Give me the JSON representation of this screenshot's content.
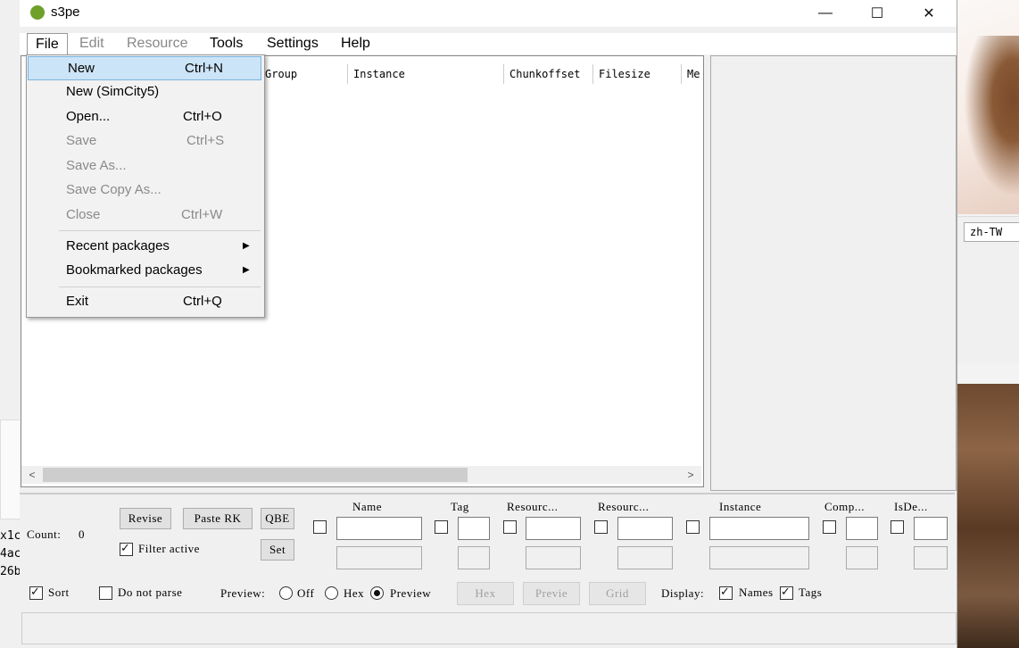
{
  "window": {
    "title": "s3pe",
    "minimize_glyph": "—",
    "maximize_glyph": "☐",
    "close_glyph": "✕"
  },
  "menubar": {
    "file": "File",
    "edit": "Edit",
    "resource": "Resource",
    "tools": "Tools",
    "settings": "Settings",
    "help": "Help"
  },
  "file_menu": {
    "new": {
      "label": "New",
      "shortcut": "Ctrl+N"
    },
    "new_simcity": {
      "label": "New (SimCity5)"
    },
    "open": {
      "label": "Open...",
      "shortcut": "Ctrl+O"
    },
    "save": {
      "label": "Save",
      "shortcut": "Ctrl+S"
    },
    "save_as": {
      "label": "Save As..."
    },
    "save_copy_as": {
      "label": "Save Copy As..."
    },
    "close": {
      "label": "Close",
      "shortcut": "Ctrl+W"
    },
    "recent": {
      "label": "Recent packages"
    },
    "bookmarked": {
      "label": "Bookmarked packages"
    },
    "exit": {
      "label": "Exit",
      "shortcut": "Ctrl+Q"
    }
  },
  "list": {
    "columns": [
      "Group",
      "Instance",
      "Chunkoffset",
      "Filesize",
      "Me"
    ]
  },
  "filter": {
    "count_label": "Count:",
    "count_value": "0",
    "revise": "Revise",
    "paste_rk": "Paste RK",
    "qbe": "QBE",
    "set": "Set",
    "filter_active": "Filter active",
    "field_headers": [
      "Name",
      "Tag",
      "Resourc...",
      "Resourc...",
      "Instance",
      "Comp...",
      "IsDe..."
    ],
    "sort": "Sort",
    "do_not_parse": "Do not parse",
    "preview_label": "Preview:",
    "preview_off": "Off",
    "preview_hex": "Hex",
    "preview_preview": "Preview",
    "btn_hex": "Hex",
    "btn_preview": "Previe",
    "btn_grid": "Grid",
    "display_label": "Display:",
    "display_names": "Names",
    "display_tags": "Tags"
  },
  "background": {
    "locale": "zh-TW",
    "left_fragments": [
      "x1c",
      "4ac",
      "26b"
    ]
  }
}
